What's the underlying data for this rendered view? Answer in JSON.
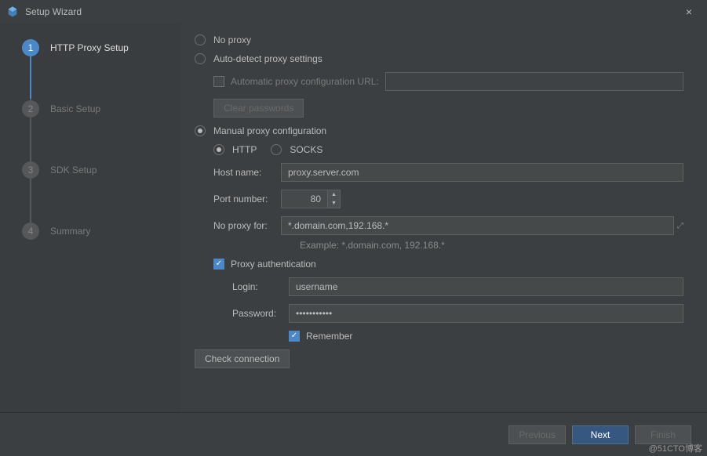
{
  "titlebar": {
    "title": "Setup Wizard"
  },
  "sidebar": {
    "steps": [
      {
        "num": "1",
        "label": "HTTP Proxy Setup"
      },
      {
        "num": "2",
        "label": "Basic Setup"
      },
      {
        "num": "3",
        "label": "SDK Setup"
      },
      {
        "num": "4",
        "label": "Summary"
      }
    ]
  },
  "proxy": {
    "no_proxy": "No proxy",
    "auto_detect": "Auto-detect proxy settings",
    "auto_url_label": "Automatic proxy configuration URL:",
    "clear_passwords": "Clear passwords",
    "manual": "Manual proxy configuration",
    "http": "HTTP",
    "socks": "SOCKS",
    "host_label": "Host name:",
    "host_value": "proxy.server.com",
    "port_label": "Port number:",
    "port_value": "80",
    "noproxy_label": "No proxy for:",
    "noproxy_value": "*.domain.com,192.168.*",
    "example": "Example: *.domain.com, 192.168.*",
    "auth_label": "Proxy authentication",
    "login_label": "Login:",
    "login_value": "username",
    "password_label": "Password:",
    "password_value": "•••••••••••",
    "remember": "Remember",
    "check": "Check connection"
  },
  "buttons": {
    "previous": "Previous",
    "next": "Next",
    "finish": "Finish"
  },
  "watermark": "@51CTO博客"
}
